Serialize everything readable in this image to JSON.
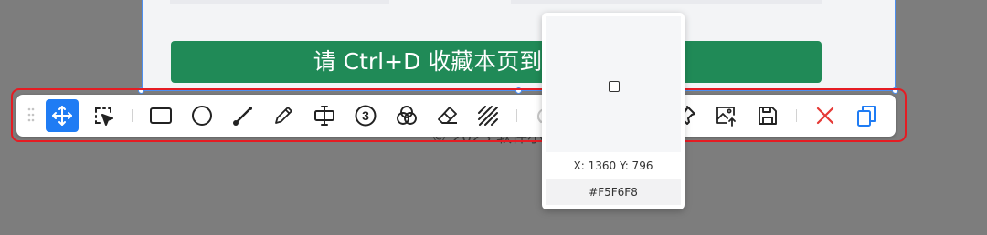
{
  "page": {
    "banner_text": "请 Ctrl+D 收藏本页到浏览器收藏夹",
    "copyright_text": "© 2023 软件小"
  },
  "toolbar": {
    "tools": [
      {
        "name": "move",
        "icon": "move-icon",
        "active": true
      },
      {
        "name": "select",
        "icon": "select-region-icon",
        "active": false
      },
      {
        "name": "rectangle",
        "icon": "rectangle-icon",
        "active": false
      },
      {
        "name": "ellipse",
        "icon": "circle-icon",
        "active": false
      },
      {
        "name": "arrow",
        "icon": "arrow-line-icon",
        "active": false
      },
      {
        "name": "pen",
        "icon": "pencil-icon",
        "active": false
      },
      {
        "name": "text",
        "icon": "text-cursor-icon",
        "active": false
      },
      {
        "name": "serial-number",
        "icon": "number-3-icon",
        "label": "3",
        "active": false
      },
      {
        "name": "blur",
        "icon": "overlap-circles-icon",
        "active": false
      },
      {
        "name": "eraser",
        "icon": "eraser-icon",
        "active": false
      },
      {
        "name": "mosaic",
        "icon": "hatch-icon",
        "active": false
      }
    ],
    "undo_disabled": true,
    "redo_disabled": true,
    "accent_color": "#1f7cf4",
    "close_color": "#e53935"
  },
  "magnifier": {
    "coord_text": "X: 1360 Y: 796",
    "color_hex": "#F5F6F8"
  }
}
